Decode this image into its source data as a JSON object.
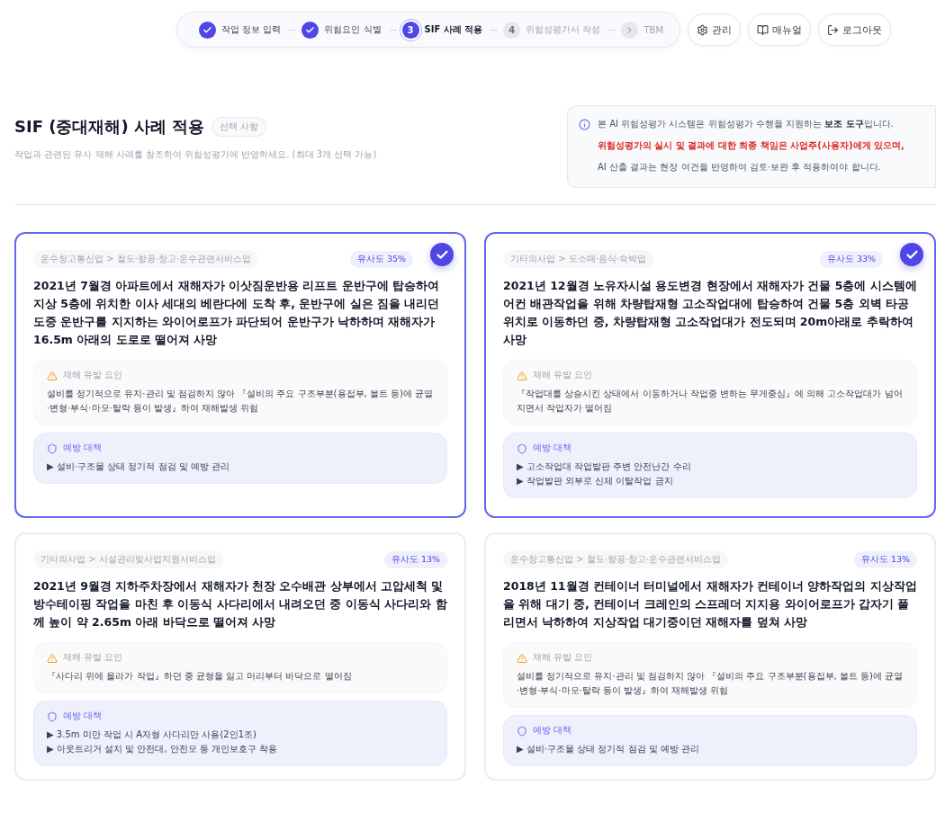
{
  "steps": [
    {
      "label": "작업 정보 입력",
      "kind": "done"
    },
    {
      "label": "위험요인 식별",
      "kind": "done"
    },
    {
      "label": "SIF 사례 적용",
      "kind": "current",
      "number": "3"
    },
    {
      "label": "위험성평가서 작성",
      "kind": "pending",
      "number": "4"
    },
    {
      "label": "TBM",
      "kind": "next"
    }
  ],
  "actions": [
    {
      "label": "관리"
    },
    {
      "label": "매뉴얼"
    },
    {
      "label": "로그아웃"
    }
  ],
  "header": {
    "title": "SIF (중대재해) 사례 적용",
    "badge": "선택 사항",
    "subtitle": "작업과 관련된 유사 재해 사례를 참조하여 위험성평가에 반영하세요. (최대 3개 선택 가능)"
  },
  "notice": {
    "lines": [
      {
        "text": "본 AI 위험성평가 시스템은 위험성평가 수행을 지원하는 **보조 도구**입니다.",
        "kind": "normal"
      },
      {
        "text": "위험성평가의 실시 및 결과에 대한 최종 책임은 사업주(사용자)에게 있으며,",
        "kind": "emphasis"
      },
      {
        "text": "AI 산출 결과는 현장 여건을 반영하여 검토·보완 후 적용하여야 합니다.",
        "kind": "normal"
      }
    ]
  },
  "cases": [
    {
      "selected": true,
      "category": "운수창고통신업 > 철도·항공·창고·운수관련서비스업",
      "similarity": "유사도 35%",
      "title": "2021년 7월경 아파트에서 재해자가 이삿짐운반용 리프트 운반구에 탑승하여 지상 5층에 위치한 이사 세대의 베란다에 도착 후, 운반구에 실은 짐을 내리던 도중 운반구를 지지하는 와이어로프가 파단되어 운반구가 낙하하며 재해자가 16.5m 아래의 도로로 떨어져 사망",
      "factor_label": "재해 유발 요인",
      "factor": "설비를 정기적으로 유지·관리 및 점검하지 않아 『설비의 주요 구조부분(용접부, 볼트 등)에 균열·변형·부식·마모·탈락 등이 발생』하여 재해발생 위험",
      "measure_label": "예방 대책",
      "measures": [
        "▶ 설비·구조물 상태 정기적 점검 및 예방 관리"
      ]
    },
    {
      "selected": true,
      "category": "기타의사업 > 도소매·음식·숙박업",
      "similarity": "유사도 33%",
      "title": "2021년 12월경 노유자시설 용도변경 현장에서 재해자가 건물 5층에 시스템에어컨 배관작업을 위해 차량탑재형 고소작업대에 탑승하여 건물 5층 외벽 타공 위치로 이동하던 중, 차량탑재형 고소작업대가 전도되며 20m아래로 추락하여 사망",
      "factor_label": "재해 유발 요인",
      "factor": "『작업대를 상승시킨 상태에서 이동하거나 작업중 변하는 무게중심』에 의해 고소작업대가 넘어지면서 작업자가 떨어짐",
      "measure_label": "예방 대책",
      "measures": [
        "▶ 고소작업대 작업발판 주변 안전난간 수리",
        "▶ 작업발판 외부로 신체 이탈작업 금지"
      ]
    },
    {
      "selected": false,
      "category": "기타의사업 > 시설관리및사업지원서비스업",
      "similarity": "유사도 13%",
      "title": "2021년 9월경 지하주차장에서 재해자가 천장 오수배관 상부에서 고압세척 및 방수테이핑 작업을 마친 후 이동식 사다리에서 내려오던 중 이동식 사다리와 함께 높이 약 2.65m 아래 바닥으로 떨어져 사망",
      "factor_label": "재해 유발 요인",
      "factor": "『사다리 위에 올라가 작업』하던 중 균형을 잃고 머리부터 바닥으로 떨어짐",
      "measure_label": "예방 대책",
      "measures": [
        "▶ 3.5m 미만 작업 시 A자형 사다리만 사용(2인1조)",
        "▶ 아웃트리거 설치 및 안전대, 안전모 등 개인보호구 착용"
      ]
    },
    {
      "selected": false,
      "category": "운수창고통신업 > 철도·항공·창고·운수관련서비스업",
      "similarity": "유사도 13%",
      "title": "2018년 11월경 컨테이너 터미널에서 재해자가 컨테이너 양하작업의 지상작업을 위해 대기 중, 컨테이너 크레인의 스프레더 지지용 와이어로프가 갑자기 풀리면서 낙하하여 지상작업 대기중이던 재해자를 덮쳐 사망",
      "factor_label": "재해 유발 요인",
      "factor": "설비를 정기적으로 유지·관리 및 점검하지 않아 『설비의 주요 구조부분(용접부, 볼트 등)에 균열·변형·부식·마모·탈락 등이 발생』하여 재해발생 위험",
      "measure_label": "예방 대책",
      "measures": [
        "▶ 설비·구조물 상태 정기적 점검 및 예방 관리"
      ]
    }
  ]
}
